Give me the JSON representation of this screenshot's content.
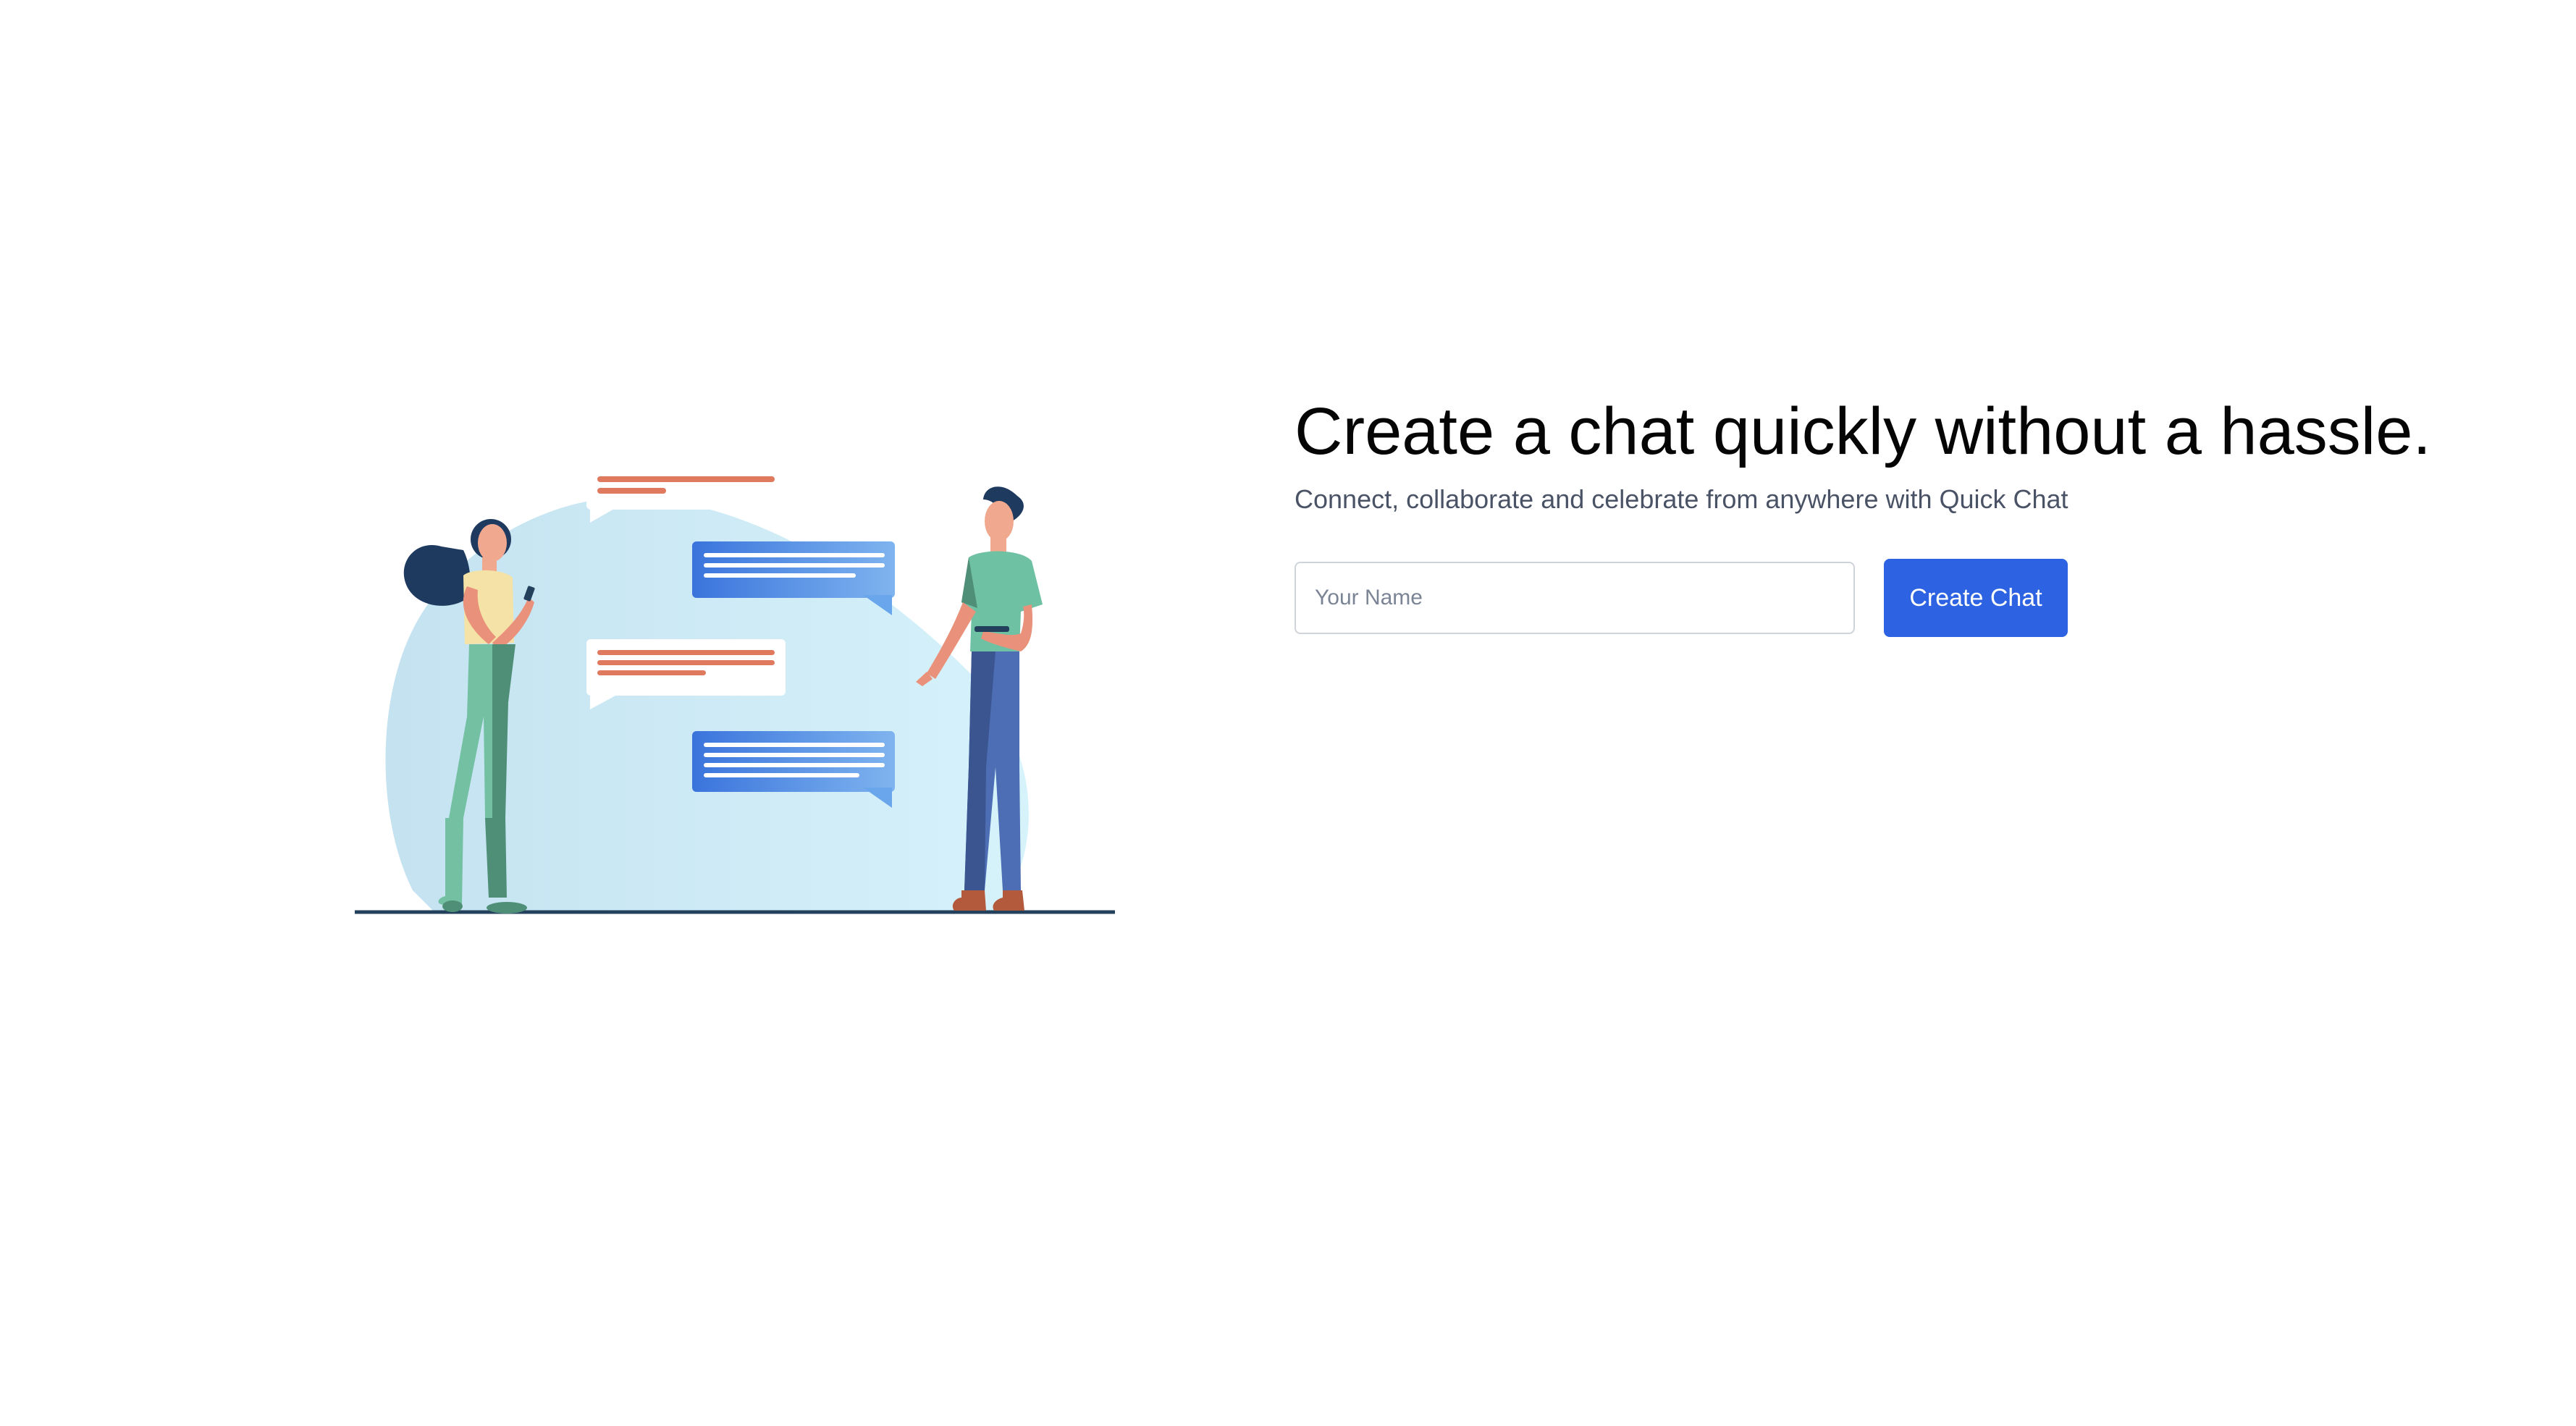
{
  "hero": {
    "headline": "Create a chat quickly without a hassle.",
    "subtitle": "Connect, collaborate and celebrate from anywhere with Quick Chat"
  },
  "form": {
    "name_input": {
      "placeholder": "Your Name",
      "value": ""
    },
    "create_button_label": "Create Chat"
  },
  "illustration": {
    "name": "two-people-chatting-illustration"
  },
  "colors": {
    "accent": "#2d63e2",
    "headline": "#050505",
    "subtitle": "#4a5366",
    "blob": "#cfeaf6",
    "bubble_orange": "#e07a5f",
    "bubble_blue": "#3d7be0"
  }
}
